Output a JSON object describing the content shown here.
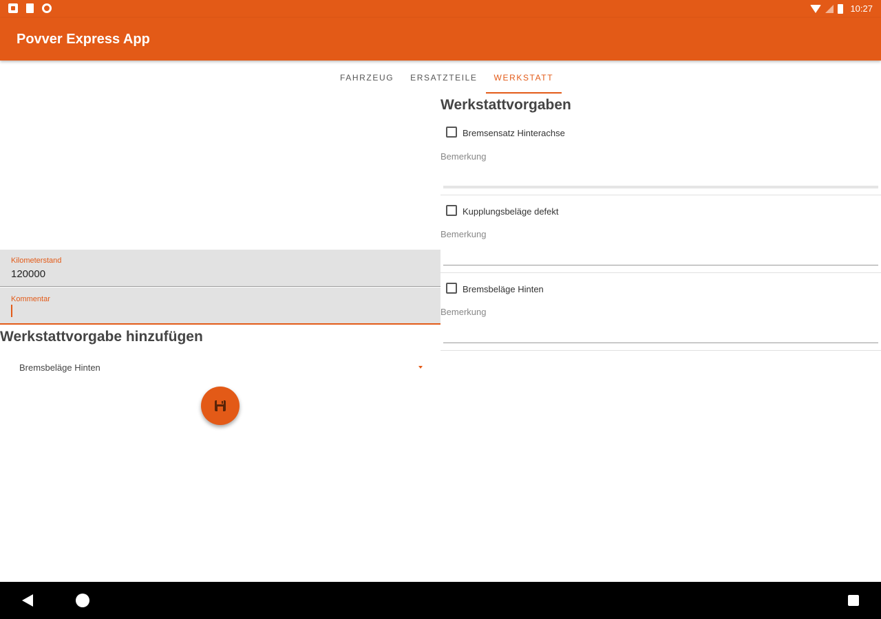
{
  "status_bar": {
    "time": "10:27",
    "icons": [
      "notification-square-icon",
      "sd-card-icon",
      "circle-icon",
      "wifi-icon",
      "cell-signal-icon",
      "battery-icon"
    ]
  },
  "app_bar": {
    "title": "Povver Express App"
  },
  "tabs": [
    {
      "label": "FAHRZEUG",
      "active": false
    },
    {
      "label": "ERSATZTEILE",
      "active": false
    },
    {
      "label": "WERKSTATT",
      "active": true
    }
  ],
  "form": {
    "km_label": "Kilometerstand",
    "km_value": "120000",
    "comment_label": "Kommentar",
    "comment_value": ""
  },
  "add_section": {
    "heading": "Werkstattvorgabe hinzufügen",
    "spinner_value": "Bremsbeläge Hinten",
    "fab_icon": "save-icon"
  },
  "list_section": {
    "heading": "Werkstattvorgaben",
    "items": [
      {
        "label": "Bremsensatz Hinterachse",
        "checked": false,
        "hint": "Bemerkung",
        "remark": ""
      },
      {
        "label": "Kupplungsbeläge defekt",
        "checked": false,
        "hint": "Bemerkung",
        "remark": ""
      },
      {
        "label": "Bremsbeläge  Hinten",
        "checked": false,
        "hint": "Bemerkung",
        "remark": ""
      }
    ]
  },
  "nav_bar": {
    "icons": [
      "back-icon",
      "home-icon",
      "recents-icon"
    ]
  },
  "colors": {
    "accent": "#e35a17",
    "field_bg": "#e2e2e2",
    "nav_bg": "#000000"
  }
}
